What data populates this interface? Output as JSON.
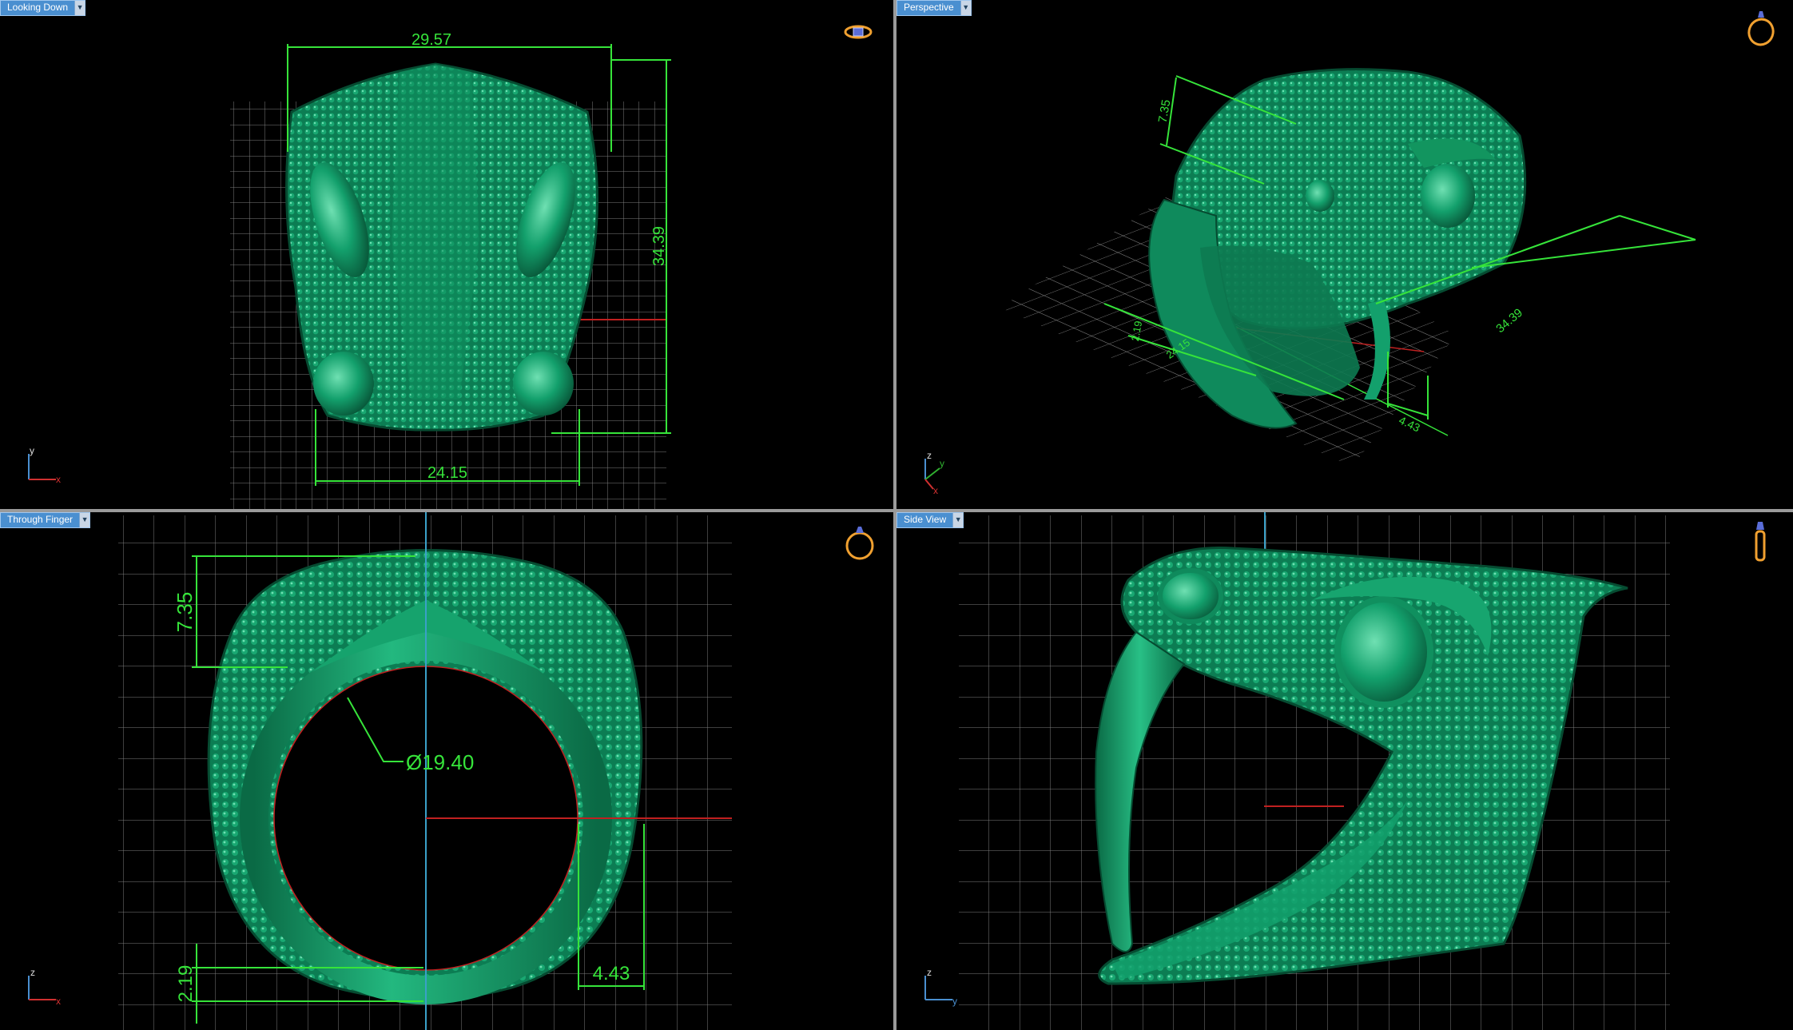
{
  "viewports": {
    "top_left": {
      "label": "Looking Down",
      "icon": "ring-top-view-icon",
      "dimensions": {
        "width_top": "29.57",
        "height": "34.39",
        "width_bottom": "24.15"
      },
      "axes": {
        "vertical": "y",
        "horizontal": "x"
      }
    },
    "top_right": {
      "label": "Perspective",
      "icon": "ring-perspective-icon",
      "dimensions": {
        "height": "7.35",
        "depth": "34.39",
        "small_a": "2.19",
        "small_b": "24.15",
        "small_c": "4.43"
      },
      "axes": {
        "vertical": "z",
        "diagonal": "y",
        "horizontal": "x"
      }
    },
    "bottom_left": {
      "label": "Through Finger",
      "icon": "ring-front-view-icon",
      "dimensions": {
        "top_thickness": "7.35",
        "inner_diameter": "Ø19.40",
        "bottom_thickness": "2.19",
        "band_width": "4.43"
      },
      "axes": {
        "vertical": "z",
        "horizontal": "x"
      }
    },
    "bottom_right": {
      "label": "Side View",
      "icon": "ring-side-view-icon",
      "axes": {
        "vertical": "z",
        "horizontal": "y"
      }
    }
  },
  "colors": {
    "model": "#0f8a5c",
    "dimension": "#36e43a",
    "grid": "#7d7d7d",
    "background": "#000000",
    "viewport_label": "#4a8fd0",
    "icon": "#f0a030"
  }
}
